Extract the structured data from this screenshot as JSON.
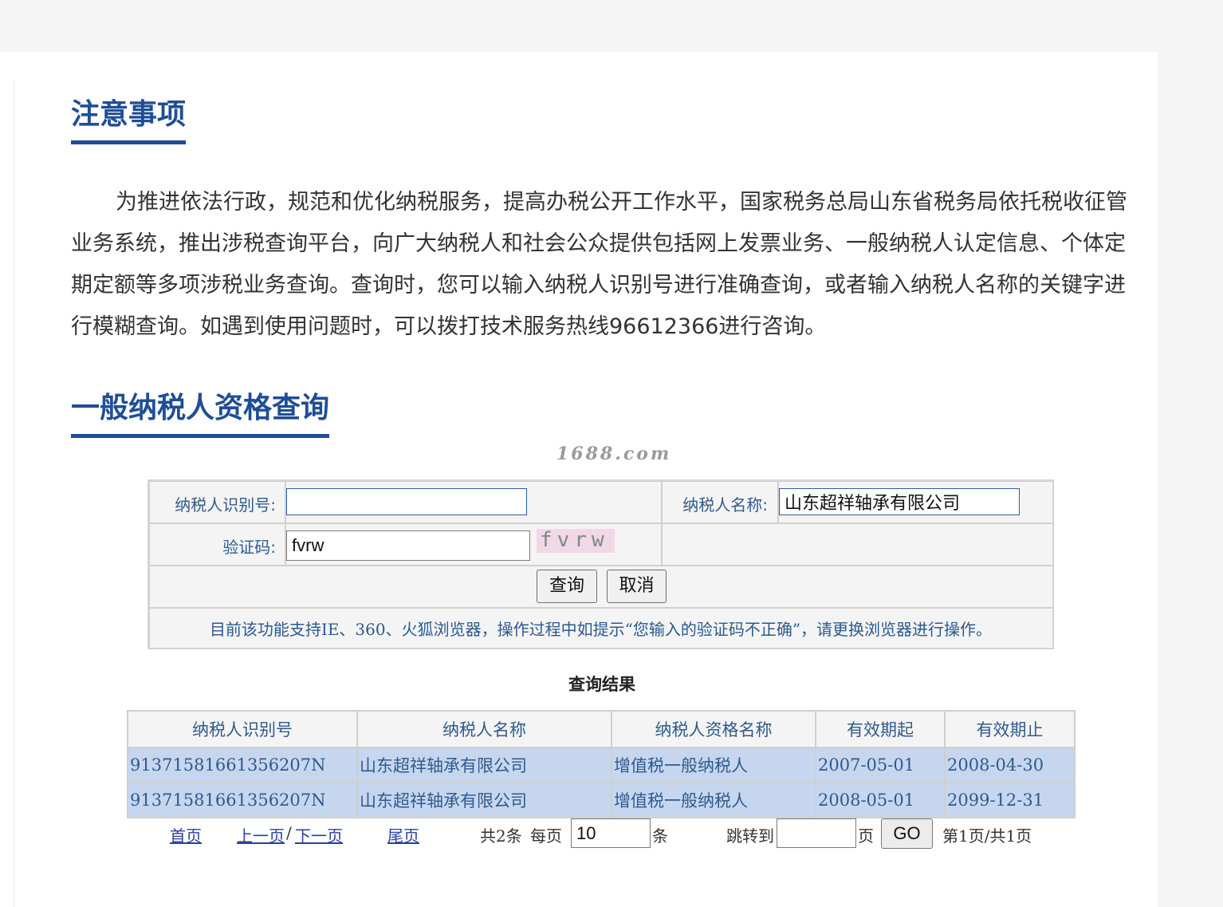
{
  "notice": {
    "title": "注意事项",
    "body": "为推进依法行政，规范和优化纳税服务，提高办税公开工作水平，国家税务总局山东省税务局依托税收征管业务系统，推出涉税查询平台，向广大纳税人和社会公众提供包括网上发票业务、一般纳税人认定信息、个体定期定额等多项涉税业务查询。查询时，您可以输入纳税人识别号进行准确查询，或者输入纳税人名称的关键字进行模糊查询。如遇到使用问题时，可以拨打技术服务热线96612366进行咨询。"
  },
  "query": {
    "title": "一般纳税人资格查询",
    "watermark": "1688.com",
    "taxpayer_id_label": "纳税人识别号:",
    "taxpayer_id_value": "",
    "taxpayer_name_label": "纳税人名称:",
    "taxpayer_name_value": "山东超祥轴承有限公司",
    "captcha_label": "验证码:",
    "captcha_value": "fvrw",
    "captcha_image_text": "fvrw",
    "query_button": "查询",
    "cancel_button": "取消",
    "hint": "目前该功能支持IE、360、火狐浏览器，操作过程中如提示“您输入的验证码不正确”，请更换浏览器进行操作。"
  },
  "results": {
    "title": "查询结果",
    "columns": [
      "纳税人识别号",
      "纳税人名称",
      "纳税人资格名称",
      "有效期起",
      "有效期止"
    ],
    "rows": [
      [
        "91371581661356207N",
        "山东超祥轴承有限公司",
        "增值税一般纳税人",
        "2007-05-01",
        "2008-04-30"
      ],
      [
        "91371581661356207N",
        "山东超祥轴承有限公司",
        "增值税一般纳税人",
        "2008-05-01",
        "2099-12-31"
      ]
    ]
  },
  "pager": {
    "first": "首页",
    "prev": "上一页",
    "separator": "/",
    "next": "下一页",
    "last": "尾页",
    "total": "共2条",
    "per_page_label": "每页",
    "per_page_value": "10",
    "per_page_unit": "条",
    "jump_label": "跳转到",
    "jump_value": "",
    "page_unit": "页",
    "go_button": "GO",
    "page_info": "第1页/共1页"
  },
  "colors": {
    "accent": "#1f4e96",
    "label_blue": "#2f5b8c",
    "row_bg": "#c7d6ef",
    "page_bg": "#f5f5f5"
  }
}
